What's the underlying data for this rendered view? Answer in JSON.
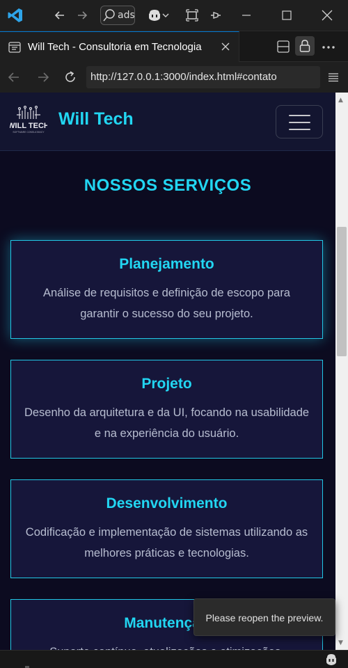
{
  "window": {
    "search_text": "ads:",
    "icons": [
      "vscode-logo-icon",
      "back-icon",
      "forward-icon",
      "search-icon",
      "copilot-icon",
      "chevron-down-icon",
      "layout-icon",
      "pin-icon",
      "minimize-icon",
      "maximize-icon",
      "close-icon"
    ]
  },
  "tab": {
    "title": "Will Tech - Consultoria em Tecnologia"
  },
  "address_bar": {
    "url": "http://127.0.0.1:3000/index.html#contato"
  },
  "site": {
    "brand_logo_text": "WILL TECH",
    "brand_logo_subtext": "SOFTWARE CONSULTANCY",
    "brand_name": "Will Tech",
    "section_title": "NOSSOS SERVIÇOS",
    "services": [
      {
        "title": "Planejamento",
        "description": "Análise de requisitos e definição de escopo para garantir o sucesso do seu projeto."
      },
      {
        "title": "Projeto",
        "description": "Desenho da arquitetura e da UI, focando na usabilidade e na experiência do usuário."
      },
      {
        "title": "Desenvolvimento",
        "description": "Codificação e implementação de sistemas utilizando as melhores práticas e tecnologias."
      },
      {
        "title": "Manutenção",
        "description": "Suporte contínuo, atualizações e otimizações."
      }
    ],
    "colors": {
      "accent": "#22d6f2",
      "background": "#0c0b20",
      "card": "#16163a"
    }
  },
  "toast": {
    "message": "Please reopen the preview."
  }
}
